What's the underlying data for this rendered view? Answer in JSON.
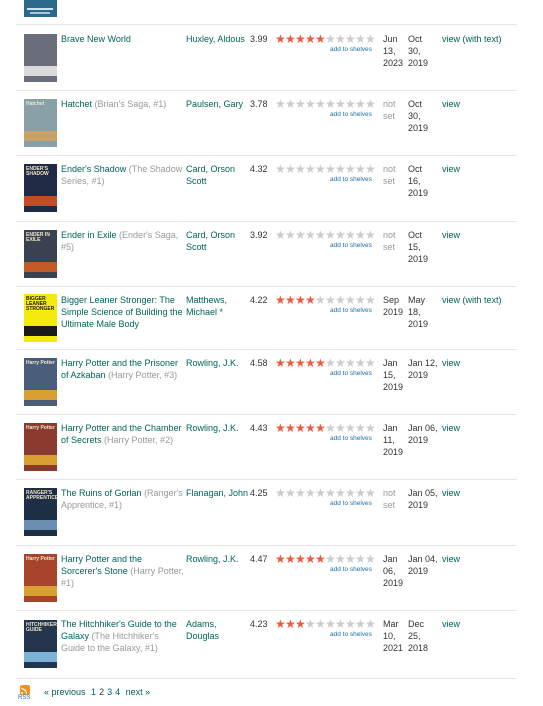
{
  "rows": [
    {
      "title": "Brave New World",
      "series": "",
      "author": "Huxley, Aldous",
      "avg": "3.99",
      "my_rating": 5,
      "add_shelves": "add to shelves",
      "read": [
        "Jun",
        "13,",
        "2023"
      ],
      "added": [
        "Oct",
        "30,",
        "2019"
      ],
      "view": "view (with text)",
      "cover_color": "#6a6e7b",
      "cover_band": "#d9d9de",
      "cover_text": ""
    },
    {
      "title": "Hatchet",
      "series": "(Brian's Saga, #1)",
      "author": "Paulsen, Gary",
      "avg": "3.78",
      "my_rating": 0,
      "add_shelves": "add to shelves",
      "read": [
        "not",
        "set"
      ],
      "added": [
        "Oct",
        "30,",
        "2019"
      ],
      "view": "view",
      "cover_color": "#8aa0a8",
      "cover_band": "#c8a068",
      "cover_text": "Hatchet"
    },
    {
      "title": "Ender's Shadow",
      "series": "(The Shadow Series, #1)",
      "author": "Card, Orson Scott",
      "avg": "4.32",
      "my_rating": 0,
      "add_shelves": "add to shelves",
      "read": [
        "not",
        "set"
      ],
      "added": [
        "Oct",
        "16,",
        "2019"
      ],
      "view": "view",
      "cover_color": "#1f2a44",
      "cover_band": "#c44b2a",
      "cover_text": "ENDER'S SHADOW"
    },
    {
      "title": "Ender in Exile",
      "series": "(Ender's Saga, #5)",
      "author": "Card, Orson Scott",
      "avg": "3.92",
      "my_rating": 0,
      "add_shelves": "add to shelves",
      "read": [
        "not",
        "set"
      ],
      "added": [
        "Oct",
        "15,",
        "2019"
      ],
      "view": "view",
      "cover_color": "#3a4150",
      "cover_band": "#c25a28",
      "cover_text": "ENDER IN EXILE"
    },
    {
      "title": "Bigger Leaner Stronger: The Simple Science of Building the Ultimate Male Body",
      "series": "",
      "author": "Matthews, Michael *",
      "avg": "4.22",
      "my_rating": 4,
      "add_shelves": "add to shelves",
      "read": [
        "Sep",
        "2019"
      ],
      "added": [
        "May",
        "18,",
        "2019"
      ],
      "view": "view (with text)",
      "cover_color": "#f5e90d",
      "cover_band": "#1a1a1a",
      "cover_text": "BIGGER LEANER STRONGER"
    },
    {
      "title": "Harry Potter and the Prisoner of Azkaban",
      "series": "(Harry Potter, #3)",
      "author": "Rowling, J.K.",
      "avg": "4.58",
      "my_rating": 5,
      "add_shelves": "add to shelves",
      "read": [
        "Jan",
        "15,",
        "2019"
      ],
      "added": [
        "Jan 12,",
        "2019"
      ],
      "view": "view",
      "cover_color": "#4a5d7a",
      "cover_band": "#d8a030",
      "cover_text": "Harry Potter"
    },
    {
      "title": "Harry Potter and the Chamber of Secrets",
      "series": "(Harry Potter, #2)",
      "author": "Rowling, J.K.",
      "avg": "4.43",
      "my_rating": 5,
      "add_shelves": "add to shelves",
      "read": [
        "Jan",
        "11,",
        "2019"
      ],
      "added": [
        "Jan 06,",
        "2019"
      ],
      "view": "view",
      "cover_color": "#8a3a2e",
      "cover_band": "#d8a030",
      "cover_text": "Harry Potter"
    },
    {
      "title": "The Ruins of Gorlan",
      "series": "(Ranger's Apprentice, #1)",
      "author": "Flanagan, John",
      "avg": "4.25",
      "my_rating": 0,
      "add_shelves": "add to shelves",
      "read": [
        "not",
        "set"
      ],
      "added": [
        "Jan 05,",
        "2019"
      ],
      "view": "view",
      "cover_color": "#1d2f45",
      "cover_band": "#6b8fb0",
      "cover_text": "RANGER'S APPRENTICE"
    },
    {
      "title": "Harry Potter and the Sorcerer's Stone",
      "series": "(Harry Potter, #1)",
      "author": "Rowling, J.K.",
      "avg": "4.47",
      "my_rating": 5,
      "add_shelves": "add to shelves",
      "read": [
        "Jan",
        "06,",
        "2019"
      ],
      "added": [
        "Jan 04,",
        "2019"
      ],
      "view": "view",
      "cover_color": "#a8442c",
      "cover_band": "#d8a030",
      "cover_text": "Harry Potter"
    },
    {
      "title": "The Hitchhiker's Guide to the Galaxy",
      "series": "(The Hitchhiker's Guide to the Galaxy, #1)",
      "author": "Adams, Douglas",
      "avg": "4.23",
      "my_rating": 3,
      "add_shelves": "add to shelves",
      "read": [
        "Mar",
        "10,",
        "2021"
      ],
      "added": [
        "Dec",
        "25,",
        "2018"
      ],
      "view": "view",
      "cover_color": "#23364e",
      "cover_band": "#7db3d8",
      "cover_text": "HITCHHIKER'S GUIDE"
    }
  ],
  "footer": {
    "rss_label": "RSS",
    "previous": "« previous",
    "pages": [
      "1",
      "2",
      "3",
      "4"
    ],
    "current_page": "2",
    "next": "next »"
  }
}
